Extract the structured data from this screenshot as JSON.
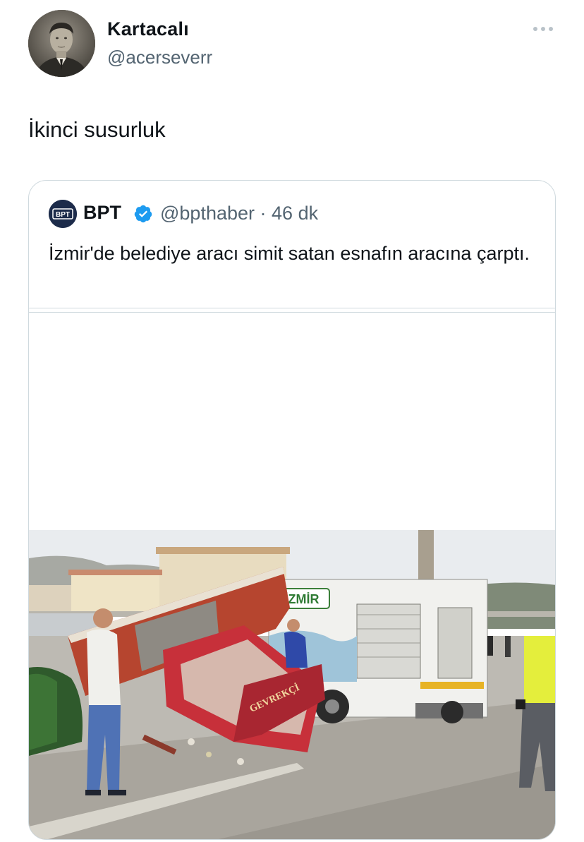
{
  "tweet": {
    "author": {
      "display_name": "Kartacalı",
      "handle": "@acerseverr"
    },
    "more_icon": "more-horizontal-icon",
    "text": "İkinci susurluk"
  },
  "quoted_tweet": {
    "author": {
      "display_name": "BPT",
      "handle": "@bpthaber",
      "timestamp": "46 dk",
      "avatar_text": "BPT",
      "verified_icon": "verified-badge-icon",
      "verified_color": "#1d9bf0"
    },
    "text": "İzmir'de belediye aracı simit satan esnafın aracına çarptı.",
    "media": {
      "truck_sign": "İZMİR",
      "kiosk_sign": "GEVREKÇİ"
    }
  },
  "colors": {
    "text_primary": "#0f1419",
    "text_secondary": "#536471",
    "border": "#cfd9de",
    "accent": "#1d9bf0"
  }
}
